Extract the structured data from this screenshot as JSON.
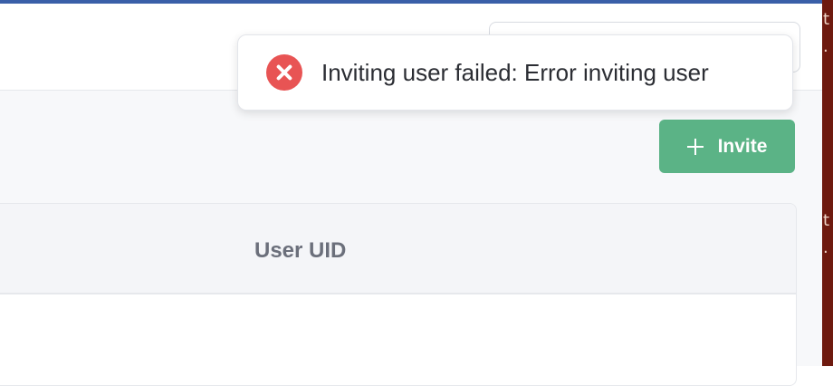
{
  "toast": {
    "icon": "error-x-icon",
    "message": "Inviting user failed: Error inviting user",
    "accent_color": "#e85454"
  },
  "toolbar": {
    "invite_label": "Invite",
    "invite_icon": "plus-icon",
    "invite_color": "#5bb386"
  },
  "table": {
    "columns": [
      "User UID"
    ]
  },
  "side_strip": {
    "glyphs": [
      "t",
      ".",
      "t",
      "."
    ]
  }
}
